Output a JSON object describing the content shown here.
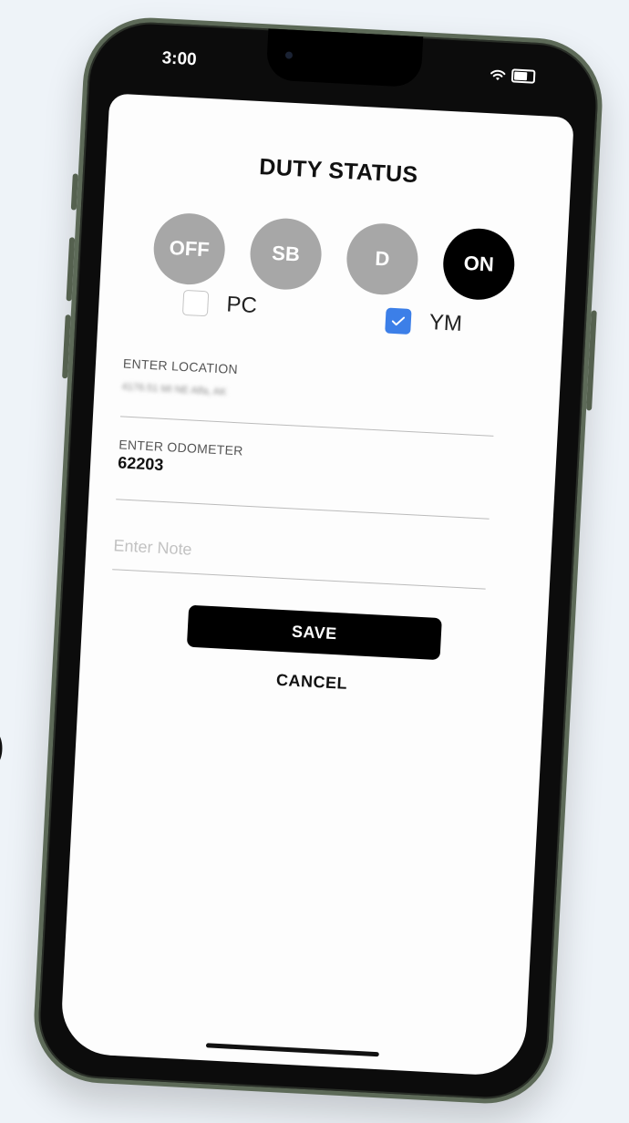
{
  "status_bar": {
    "time": "3:00",
    "wifi_icon": "wifi-icon",
    "battery_icon": "battery-icon"
  },
  "screen": {
    "title": "DUTY STATUS",
    "duty_buttons": [
      {
        "label": "OFF",
        "active": false
      },
      {
        "label": "SB",
        "active": false
      },
      {
        "label": "D",
        "active": false
      },
      {
        "label": "ON",
        "active": true
      }
    ],
    "checkboxes": {
      "pc": {
        "label": "PC",
        "checked": false
      },
      "ym": {
        "label": "YM",
        "checked": true
      }
    },
    "location": {
      "label": "ENTER LOCATION",
      "value": "4176.51 MI NE Alfa, AK"
    },
    "odometer": {
      "label": "ENTER ODOMETER",
      "value": "62203"
    },
    "note": {
      "placeholder": "Enter Note",
      "value": ""
    },
    "save_label": "SAVE",
    "cancel_label": "CANCEL"
  },
  "colors": {
    "inactive_status": "#a7a7a7",
    "active_status": "#000000",
    "checkbox_checked": "#3c7fe8",
    "phone_frame": "#5d6a58"
  },
  "edge_glyph": ")"
}
